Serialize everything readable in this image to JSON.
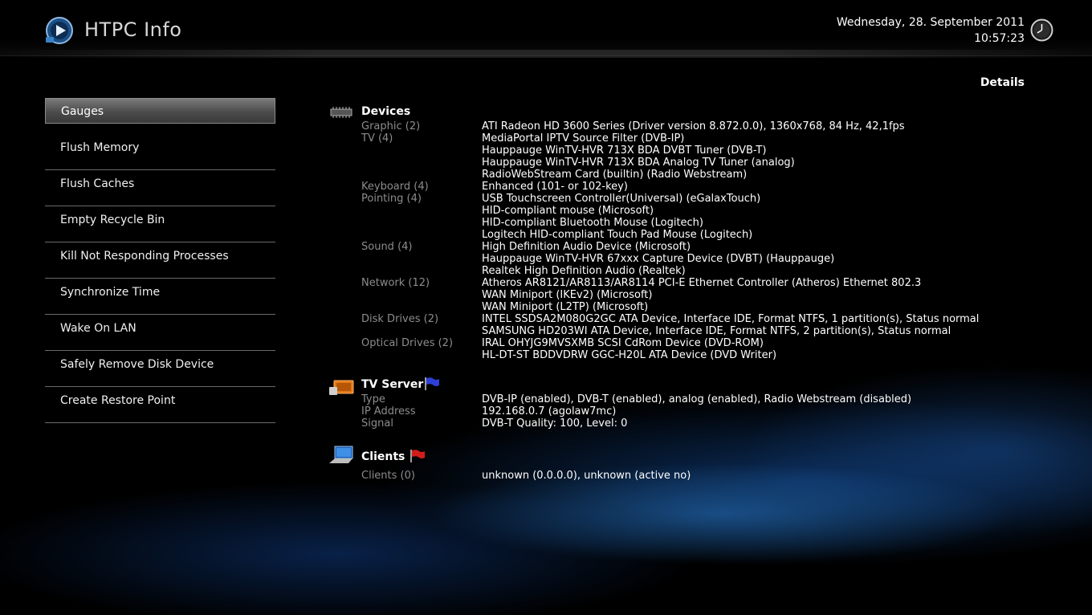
{
  "header": {
    "app_title": "HTPC Info",
    "date": "Wednesday, 28. September 2011",
    "time": "10:57:23",
    "details_label": "Details"
  },
  "menu": [
    {
      "label": "Gauges",
      "selected": true
    },
    {
      "label": "Flush Memory"
    },
    {
      "label": "Flush Caches"
    },
    {
      "label": "Empty Recycle Bin"
    },
    {
      "label": "Kill Not Responding Processes"
    },
    {
      "label": "Synchronize Time"
    },
    {
      "label": "Wake On LAN"
    },
    {
      "label": "Safely Remove Disk Device"
    },
    {
      "label": "Create Restore Point"
    }
  ],
  "icons": {
    "logo": "htpc-logo-icon",
    "clock": "clock-icon",
    "devices": "chip-icon",
    "tv_server": "tv-server-icon",
    "clients": "laptop-icon",
    "tv_flag": "blue-flag-icon",
    "clients_flag": "red-flag-icon"
  },
  "devices": {
    "title": "Devices",
    "rows": [
      {
        "key": "Graphic (2)",
        "value": "ATI Radeon HD 3600 Series (Driver version 8.872.0.0), 1360x768, 84 Hz, 42,1fps"
      },
      {
        "key": "TV (4)",
        "value": "MediaPortal IPTV Source Filter (DVB-IP)"
      },
      {
        "key": "",
        "value": "Hauppauge WinTV-HVR 713X BDA DVBT Tuner (DVB-T)"
      },
      {
        "key": "",
        "value": "Hauppauge WinTV-HVR 713X BDA Analog TV Tuner (analog)"
      },
      {
        "key": "",
        "value": "RadioWebStream Card (builtin) (Radio Webstream)"
      },
      {
        "key": "Keyboard (4)",
        "value": "Enhanced (101- or 102-key)"
      },
      {
        "key": "Pointing (4)",
        "value": "USB Touchscreen Controller(Universal) (eGalaxTouch)"
      },
      {
        "key": "",
        "value": "HID-compliant mouse (Microsoft)"
      },
      {
        "key": "",
        "value": "HID-compliant Bluetooth Mouse (Logitech)"
      },
      {
        "key": "",
        "value": "Logitech HID-compliant Touch Pad Mouse (Logitech)"
      },
      {
        "key": "Sound (4)",
        "value": "High Definition Audio Device (Microsoft)"
      },
      {
        "key": "",
        "value": "Hauppauge WinTV-HVR 67xxx Capture Device (DVBT) (Hauppauge)"
      },
      {
        "key": "",
        "value": "Realtek High Definition Audio (Realtek)"
      },
      {
        "key": "Network (12)",
        "value": "Atheros AR8121/AR8113/AR8114 PCI-E Ethernet Controller (Atheros) Ethernet 802.3"
      },
      {
        "key": "",
        "value": "WAN Miniport (IKEv2) (Microsoft)"
      },
      {
        "key": "",
        "value": "WAN Miniport (L2TP) (Microsoft)"
      },
      {
        "key": "Disk Drives (2)",
        "value": "INTEL SSDSA2M080G2GC ATA Device, Interface IDE, Format NTFS, 1 partition(s), Status normal"
      },
      {
        "key": "",
        "value": "SAMSUNG HD203WI ATA Device, Interface IDE, Format NTFS, 2 partition(s), Status normal"
      },
      {
        "key": "Optical Drives (2)",
        "value": "IRAL OHYJG9MVSXMB SCSI CdRom Device (DVD-ROM)"
      },
      {
        "key": "",
        "value": "HL-DT-ST BDDVDRW GGC-H20L ATA Device (DVD Writer)"
      }
    ]
  },
  "tv_server": {
    "title": "TV Server",
    "rows": [
      {
        "key": "Type",
        "value": "DVB-IP (enabled), DVB-T (enabled), analog (enabled), Radio Webstream (disabled)"
      },
      {
        "key": "IP Address",
        "value": "192.168.0.7 (agolaw7mc)"
      },
      {
        "key": "Signal",
        "value": "DVB-T Quality: 100, Level: 0"
      }
    ]
  },
  "clients": {
    "title": "Clients",
    "rows": [
      {
        "key": "Clients (0)",
        "value": "unknown (0.0.0.0), unknown (active no)"
      }
    ]
  }
}
